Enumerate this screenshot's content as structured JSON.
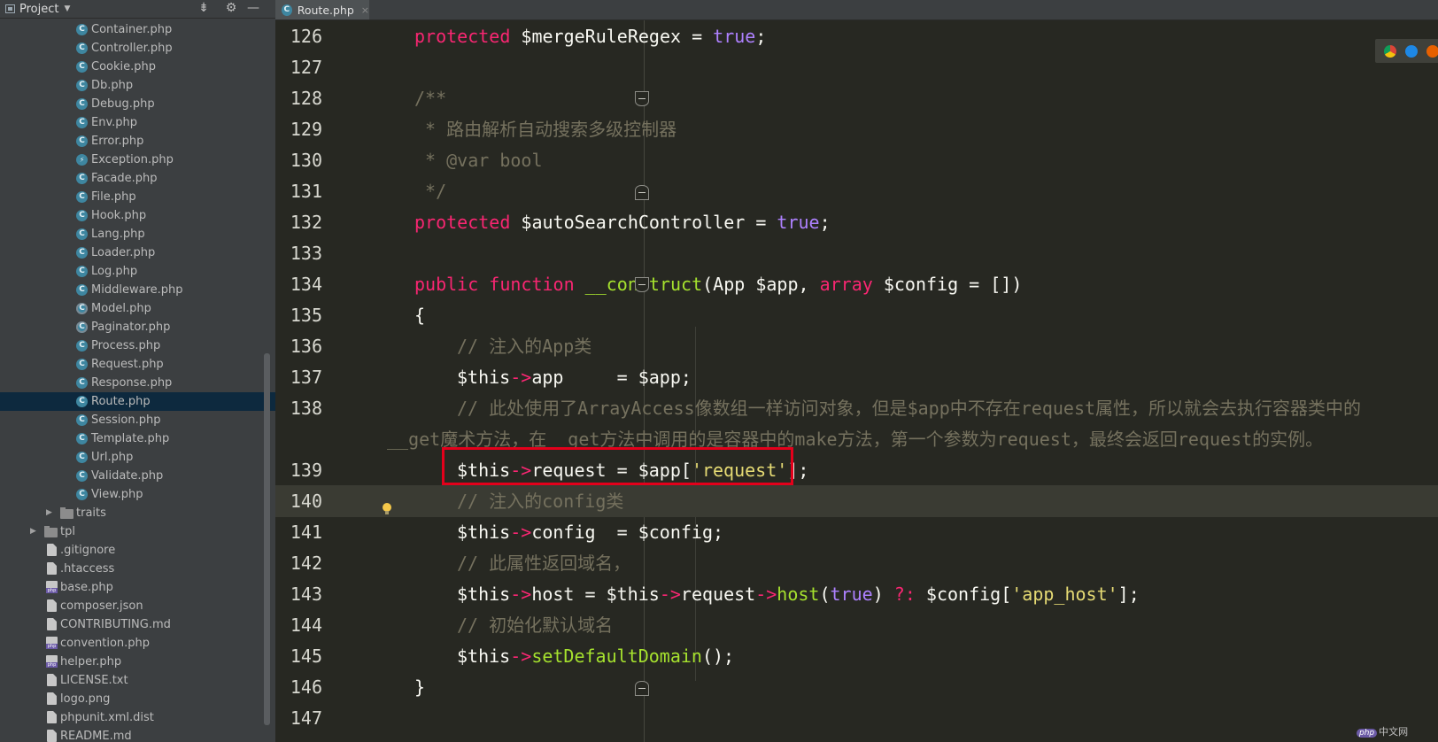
{
  "sidebar": {
    "title": "Project",
    "items": [
      {
        "label": "Container.php",
        "type": "class"
      },
      {
        "label": "Controller.php",
        "type": "class"
      },
      {
        "label": "Cookie.php",
        "type": "class"
      },
      {
        "label": "Db.php",
        "type": "class"
      },
      {
        "label": "Debug.php",
        "type": "class"
      },
      {
        "label": "Env.php",
        "type": "class"
      },
      {
        "label": "Error.php",
        "type": "class"
      },
      {
        "label": "Exception.php",
        "type": "exception"
      },
      {
        "label": "Facade.php",
        "type": "class"
      },
      {
        "label": "File.php",
        "type": "class"
      },
      {
        "label": "Hook.php",
        "type": "class"
      },
      {
        "label": "Lang.php",
        "type": "class"
      },
      {
        "label": "Loader.php",
        "type": "class"
      },
      {
        "label": "Log.php",
        "type": "class"
      },
      {
        "label": "Middleware.php",
        "type": "class"
      },
      {
        "label": "Model.php",
        "type": "abstract"
      },
      {
        "label": "Paginator.php",
        "type": "abstract"
      },
      {
        "label": "Process.php",
        "type": "class"
      },
      {
        "label": "Request.php",
        "type": "class"
      },
      {
        "label": "Response.php",
        "type": "class"
      },
      {
        "label": "Route.php",
        "type": "class",
        "selected": true
      },
      {
        "label": "Session.php",
        "type": "class"
      },
      {
        "label": "Template.php",
        "type": "class"
      },
      {
        "label": "Url.php",
        "type": "class"
      },
      {
        "label": "Validate.php",
        "type": "class"
      },
      {
        "label": "View.php",
        "type": "class"
      }
    ],
    "folders": [
      {
        "label": "traits"
      },
      {
        "label": "tpl"
      }
    ],
    "root_files": [
      {
        "label": ".gitignore",
        "type": "file"
      },
      {
        "label": ".htaccess",
        "type": "file"
      },
      {
        "label": "base.php",
        "type": "php"
      },
      {
        "label": "composer.json",
        "type": "file"
      },
      {
        "label": "CONTRIBUTING.md",
        "type": "file"
      },
      {
        "label": "convention.php",
        "type": "php"
      },
      {
        "label": "helper.php",
        "type": "php"
      },
      {
        "label": "LICENSE.txt",
        "type": "file"
      },
      {
        "label": "logo.png",
        "type": "file"
      },
      {
        "label": "phpunit.xml.dist",
        "type": "file"
      },
      {
        "label": "README.md",
        "type": "file"
      }
    ]
  },
  "tab": {
    "label": "Route.php",
    "close": "×"
  },
  "editor": {
    "current_line": 140,
    "lines": [
      {
        "n": "126",
        "tokens": [
          "protected",
          " $mergeRuleRegex = ",
          "true",
          ";"
        ]
      },
      {
        "n": "127"
      },
      {
        "n": "128",
        "comment": "/**"
      },
      {
        "n": "129",
        "comment": " * 路由解析自动搜索多级控制器"
      },
      {
        "n": "130",
        "comment": " * @var bool"
      },
      {
        "n": "131",
        "comment": " */"
      },
      {
        "n": "132",
        "tokens": [
          "protected",
          " $autoSearchController = ",
          "true",
          ";"
        ]
      },
      {
        "n": "133"
      },
      {
        "n": "134",
        "tokens": [
          "public function",
          " ",
          "__construct",
          "(App $app, ",
          "array",
          " $config = [])"
        ]
      },
      {
        "n": "135",
        "text": "{"
      },
      {
        "n": "136",
        "comment": "// 注入的App类"
      },
      {
        "n": "137",
        "tokens": [
          "$this",
          "->",
          "app     = $app;"
        ]
      },
      {
        "n": "138",
        "comment": "// 此处使用了ArrayAccess像数组一样访问对象，但是$app中不存在request属性，所以就会去执行容器类中的",
        "continuation": "__get魔术方法，在__get方法中调用的是容器中的make方法，第一个参数为request，最终会返回request的实例。"
      },
      {
        "n": "139",
        "tokens": [
          "$this",
          "->",
          "request = $app[",
          "'request'",
          "];"
        ]
      },
      {
        "n": "140",
        "comment": "// 注入的config类"
      },
      {
        "n": "141",
        "tokens": [
          "$this",
          "->",
          "config  = $config;"
        ]
      },
      {
        "n": "142",
        "comment": "// 此属性返回域名，"
      },
      {
        "n": "143",
        "tokens": [
          "$this",
          "->",
          "host = $this",
          "->",
          "request",
          "->",
          "host",
          "(",
          "true",
          ") ",
          "?:",
          " $config[",
          "'app_host'",
          "];"
        ]
      },
      {
        "n": "144",
        "comment": "// 初始化默认域名"
      },
      {
        "n": "145",
        "tokens": [
          "$this",
          "->",
          "setDefaultDomain",
          "();"
        ]
      },
      {
        "n": "146",
        "text": "}"
      },
      {
        "n": "147"
      }
    ]
  },
  "watermark": {
    "logo": "php",
    "text": "中文网"
  },
  "colors": {
    "keyword": "#f92672",
    "constant": "#ae81ff",
    "comment": "#75715e",
    "string": "#e6db74",
    "function": "#a6e22e",
    "highlight_box": "#e3001b"
  }
}
